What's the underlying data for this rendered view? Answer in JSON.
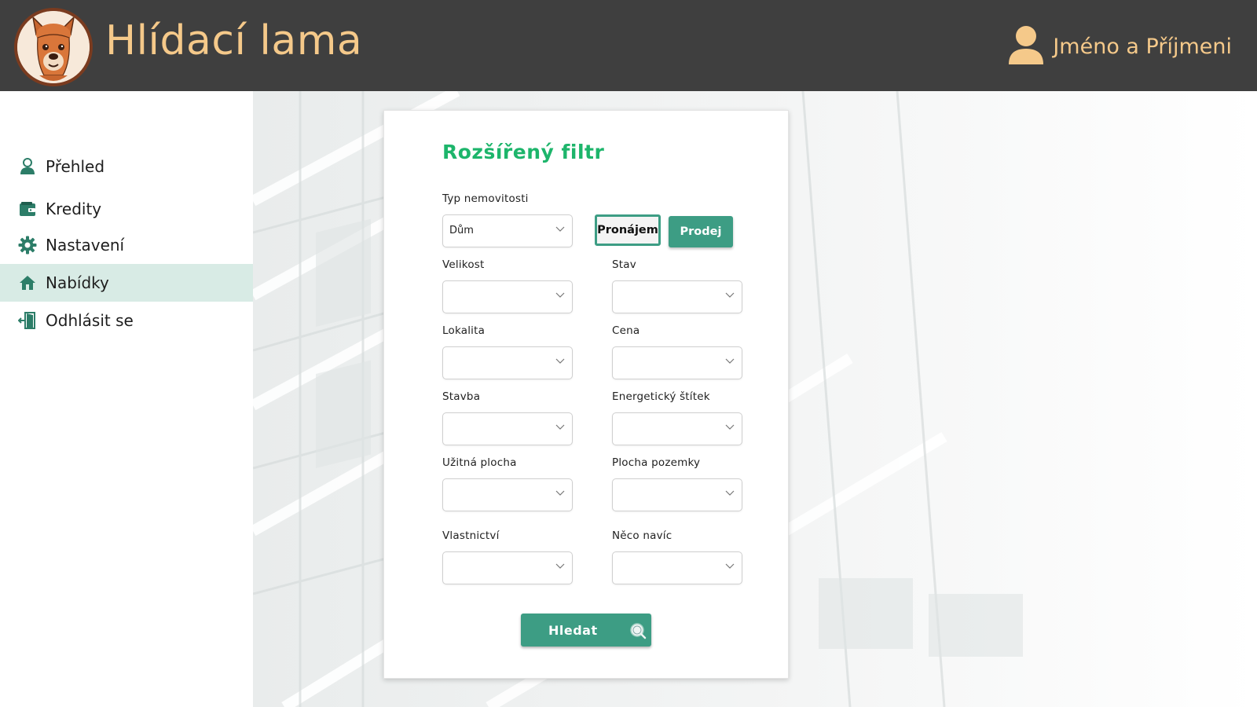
{
  "app": {
    "title": "Hlídací lama"
  },
  "user": {
    "name": "Jméno a Příjmeni"
  },
  "sidebar": {
    "items": [
      {
        "label": "Přehled",
        "icon": "person-icon",
        "active": false
      },
      {
        "label": "Kredity",
        "icon": "wallet-icon",
        "active": false
      },
      {
        "label": "Nastavení",
        "icon": "gear-icon",
        "active": false
      },
      {
        "label": "Nabídky",
        "icon": "home-icon",
        "active": true
      },
      {
        "label": "Odhlásit se",
        "icon": "logout-icon",
        "active": false
      }
    ]
  },
  "filter": {
    "title": "Rozšířený filtr",
    "property_type": {
      "label": "Typ nemovitosti",
      "value": "Dům"
    },
    "rent_label": "Pronájem",
    "sale_label": "Prodej",
    "fields": {
      "velikost": {
        "label": "Velikost",
        "value": ""
      },
      "stav": {
        "label": "Stav",
        "value": ""
      },
      "lokalita": {
        "label": "Lokalita",
        "value": ""
      },
      "cena": {
        "label": "Cena",
        "value": ""
      },
      "stavba": {
        "label": "Stavba",
        "value": ""
      },
      "energeticky_stitek": {
        "label": "Energetický štítek",
        "value": ""
      },
      "uzitna_plocha": {
        "label": "Užitná plocha",
        "value": ""
      },
      "plocha_pozemky": {
        "label": "Plocha pozemky",
        "value": ""
      },
      "vlastnictvi": {
        "label": "Vlastnictví",
        "value": ""
      },
      "neco_navic": {
        "label": "Něco navíc",
        "value": ""
      }
    },
    "search_label": "Hledat"
  },
  "colors": {
    "header_bg": "#3f3f3f",
    "header_text": "#f5c98a",
    "accent": "#3d9d84",
    "title_green": "#1db56b",
    "active_nav_bg": "#d8ebe5"
  }
}
